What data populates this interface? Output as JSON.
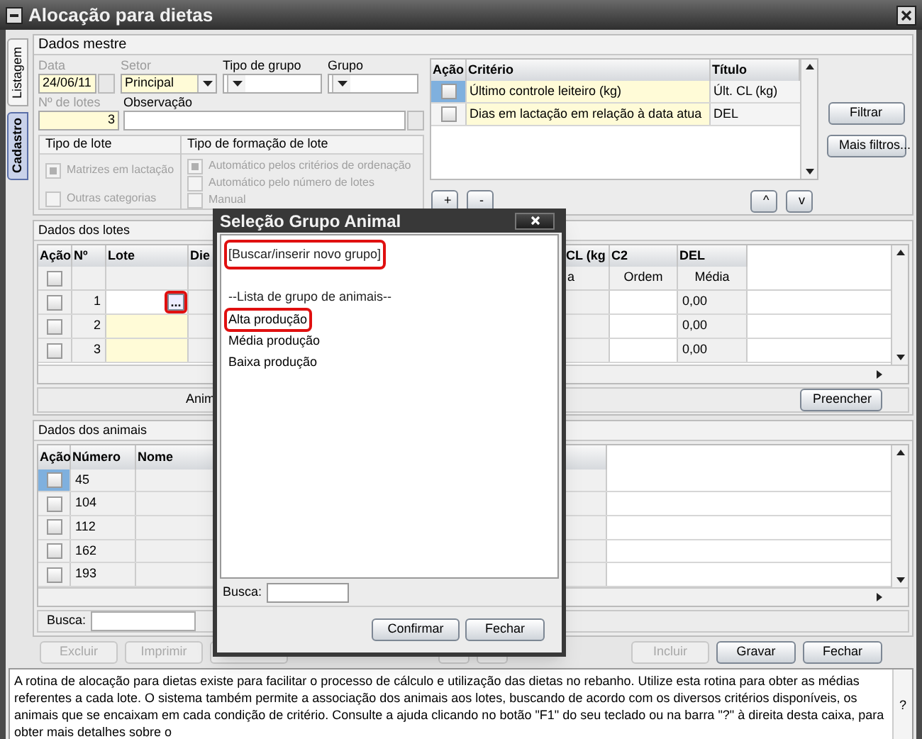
{
  "window": {
    "title": "Alocação para dietas"
  },
  "side_tabs": [
    {
      "label": "Listagem",
      "selected": false
    },
    {
      "label": "Cadastro",
      "selected": true
    }
  ],
  "master": {
    "title": "Dados mestre",
    "fields": [
      {
        "label": "Data",
        "value": "24/06/11",
        "disabled": true,
        "kind": "date"
      },
      {
        "label": "Setor",
        "value": "Principal",
        "disabled": true,
        "kind": "select"
      },
      {
        "label": "Tipo de grupo",
        "disabled": false,
        "kind": "select"
      },
      {
        "label": "Grupo",
        "disabled": false,
        "kind": "select"
      },
      {
        "label": "Nº de lotes",
        "value": "3",
        "disabled": true,
        "kind": "number"
      },
      {
        "label": "Observação",
        "disabled": false,
        "kind": "text"
      }
    ],
    "lot_type": {
      "title": "Tipo de lote",
      "options": [
        {
          "label": "Matrizes em lactação",
          "checked": true,
          "disabled": true
        },
        {
          "label": "Outras categorias",
          "checked": false,
          "disabled": true
        }
      ]
    },
    "formation_type": {
      "title": "Tipo de formação de lote",
      "options": [
        {
          "label": "Automático pelos critérios de ordenação",
          "checked": true,
          "disabled": true
        },
        {
          "label": "Automático pelo número de lotes",
          "checked": false,
          "disabled": true
        },
        {
          "label": "Manual",
          "checked": false,
          "disabled": true
        }
      ]
    }
  },
  "criteria": {
    "columns": [
      "Ação",
      "Critério",
      "Título"
    ],
    "rows": [
      {
        "selected": true,
        "checked": false,
        "criterio": "Último controle leiteiro (kg)",
        "titulo": "Últ. CL (kg)"
      },
      {
        "selected": false,
        "checked": false,
        "criterio": "Dias em lactação em relação à data atua",
        "titulo": "DEL"
      }
    ],
    "buttons": [
      "Filtrar",
      "Mais filtros..."
    ],
    "add": "+",
    "remove": "-",
    "up": "^",
    "down": "v"
  },
  "lots": {
    "title": "Dados dos lotes",
    "columns": [
      "Ação",
      "Nº",
      "Lote",
      "Die",
      "CL (kg",
      "C2",
      "DEL"
    ],
    "header_checkbox": {
      "checked": false
    },
    "subheader": [
      "a",
      "Ordem",
      "Média"
    ],
    "rows": [
      {
        "checked": false,
        "n": "1",
        "editing": true,
        "del": "0,00"
      },
      {
        "checked": false,
        "n": "2",
        "editing": false,
        "del": "0,00"
      },
      {
        "checked": false,
        "n": "3",
        "editing": false,
        "del": "0,00"
      }
    ],
    "browse_button": "...",
    "fill_label": "Anim",
    "fill_button": "Preencher"
  },
  "animals": {
    "title": "Dados dos animais",
    "columns": [
      "Ação",
      "Número",
      "Nome"
    ],
    "rows": [
      {
        "selected": true,
        "checked": false,
        "numero": "45"
      },
      {
        "selected": false,
        "checked": false,
        "numero": "104"
      },
      {
        "selected": false,
        "checked": false,
        "numero": "112"
      },
      {
        "selected": false,
        "checked": false,
        "numero": "162"
      },
      {
        "selected": false,
        "checked": false,
        "numero": "193"
      }
    ],
    "search_label": "Busca:"
  },
  "footer_buttons": [
    {
      "label": "Excluir",
      "disabled": true
    },
    {
      "label": "Imprimir",
      "disabled": true
    },
    {
      "label": "Incluir",
      "disabled": true
    },
    {
      "label": "Gravar",
      "disabled": false
    },
    {
      "label": "Fechar",
      "disabled": false
    }
  ],
  "help": {
    "text": "A rotina de alocação para dietas existe para facilitar o processo de cálculo e utilização das dietas no rebanho. Utilize esta rotina para obter as médias referentes a cada lote. O sistema também permite a associação dos animais aos lotes, buscando de acordo com os diversos critérios disponíveis, os animais que se encaixam em cada condição de critério. Consulte a ajuda clicando no botão \"F1\" do seu teclado ou na barra \"?\" à direita desta caixa, para obter mais detalhes sobre o",
    "button": "?"
  },
  "dialog": {
    "title": "Seleção Grupo Animal",
    "items": [
      {
        "kind": "search",
        "label": "[Buscar/inserir novo grupo]",
        "highlighted": true
      },
      {
        "kind": "heading",
        "label": "--Lista de grupo de animais--",
        "highlighted": false
      },
      {
        "kind": "item",
        "label": "Alta produção",
        "highlighted": true
      },
      {
        "kind": "item",
        "label": "Média produção",
        "highlighted": false
      },
      {
        "kind": "item",
        "label": "Baixa produção",
        "highlighted": false
      }
    ],
    "search_label": "Busca:",
    "buttons": [
      "Confirmar",
      "Fechar"
    ]
  }
}
